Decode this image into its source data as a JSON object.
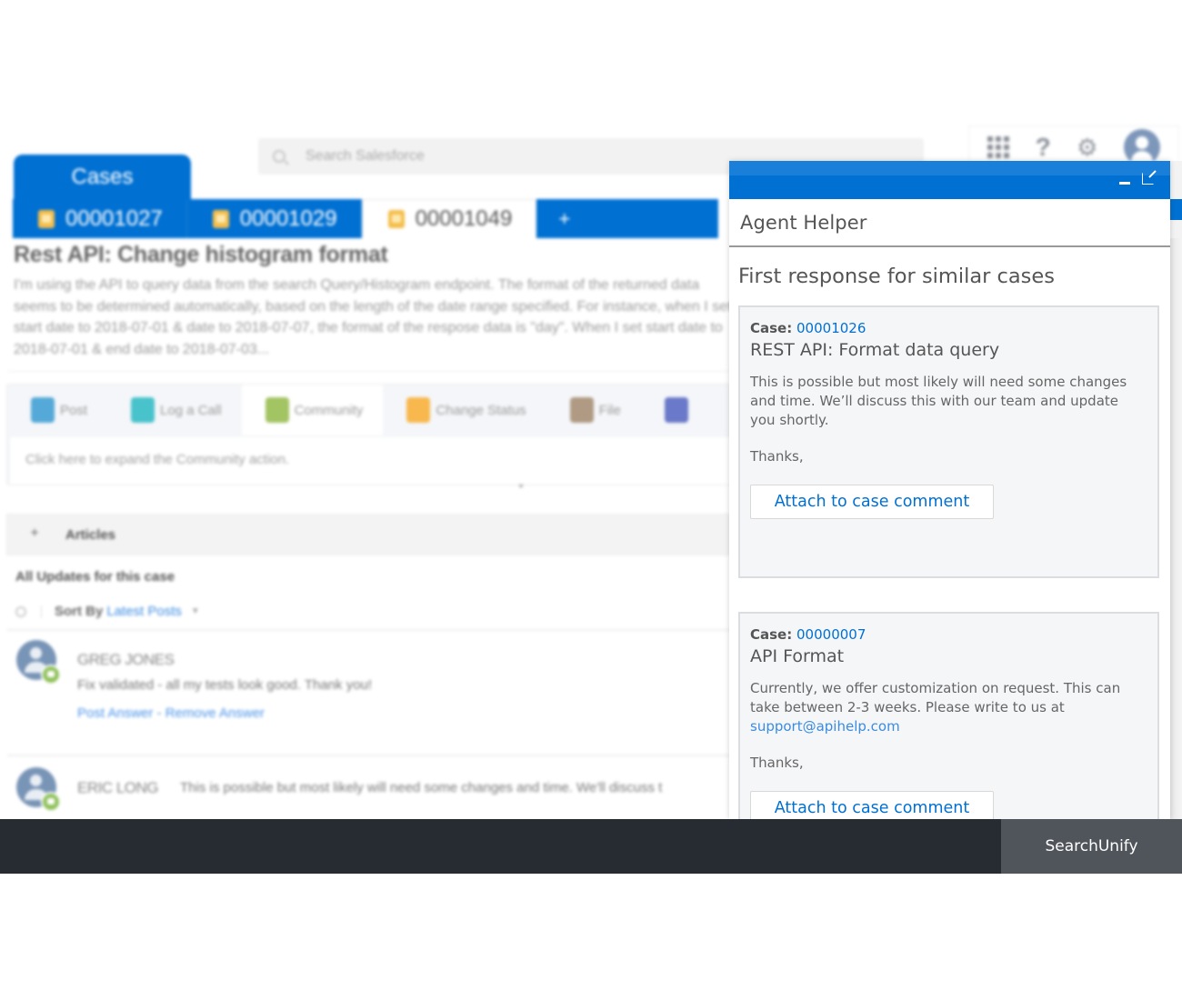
{
  "header": {
    "search_placeholder": "Search Salesforce",
    "icons": [
      "app-launcher-icon",
      "help-icon",
      "gear-icon",
      "user-avatar-icon"
    ]
  },
  "app_tab": {
    "label": "Cases"
  },
  "case_tabs": [
    {
      "label": "00001027",
      "active": false
    },
    {
      "label": "00001029",
      "active": false
    },
    {
      "label": "00001049",
      "active": true
    }
  ],
  "add_tab_label": "+",
  "case": {
    "title": "Rest API: Change histogram format",
    "description": "I'm using the API to query data from the search Query/Histogram endpoint. The format of the returned data seems to be determined automatically, based on the length of the date range specified. For instance, when I set start date to 2018-07-01 & date to 2018-07-07, the format of the respose data is \"day\". When I set start date to 2018-07-01 & end date to 2018-07-03..."
  },
  "actions": {
    "tabs": [
      {
        "label": "Post",
        "icon": "post-icon",
        "color": "#54a9d8"
      },
      {
        "label": "Log a Call",
        "icon": "phone-icon",
        "color": "#48c3cc"
      },
      {
        "label": "Community",
        "icon": "community-icon",
        "color": "#a3c463",
        "active": true
      },
      {
        "label": "Change Status",
        "icon": "lightning-icon",
        "color": "#f8b84e"
      },
      {
        "label": "File",
        "icon": "file-icon",
        "color": "#b09a83"
      },
      {
        "label": "",
        "icon": "link-icon",
        "color": "#6a79c9"
      }
    ],
    "body_text": "Click here to expand the Community action."
  },
  "articles": {
    "label": "Articles",
    "expand": "+"
  },
  "updates": {
    "title": "All Updates for this case",
    "sort_label": "Sort By",
    "sort_value": "Latest Posts"
  },
  "feed": [
    {
      "name": "GREG JONES",
      "text": "Fix validated - all my tests look good. Thank you!",
      "links": "Post Answer - Remove Answer"
    },
    {
      "name": "ERIC LONG",
      "text": "This is possible but most likely will need some changes and time. We'll discuss t"
    }
  ],
  "helper": {
    "title": "Agent Helper",
    "heading": "First response for similar cases",
    "responses": [
      {
        "case_label": "Case:",
        "case_number": "00001026",
        "title": "REST API: Format data query",
        "text": "This is possible but most likely will need some changes and time. We’ll discuss this with our team and update you shortly.",
        "email": "",
        "thanks": "Thanks,",
        "button": "Attach to case comment"
      },
      {
        "case_label": "Case:",
        "case_number": "00000007",
        "title": "API Format",
        "text": "Currently, we offer customization on request. This can take between 2-3 weeks. Please write to us at",
        "email": "support@apihelp.com",
        "thanks": "Thanks,",
        "button": "Attach to case comment"
      }
    ]
  },
  "footer": {
    "brand": "SearchUnify"
  }
}
